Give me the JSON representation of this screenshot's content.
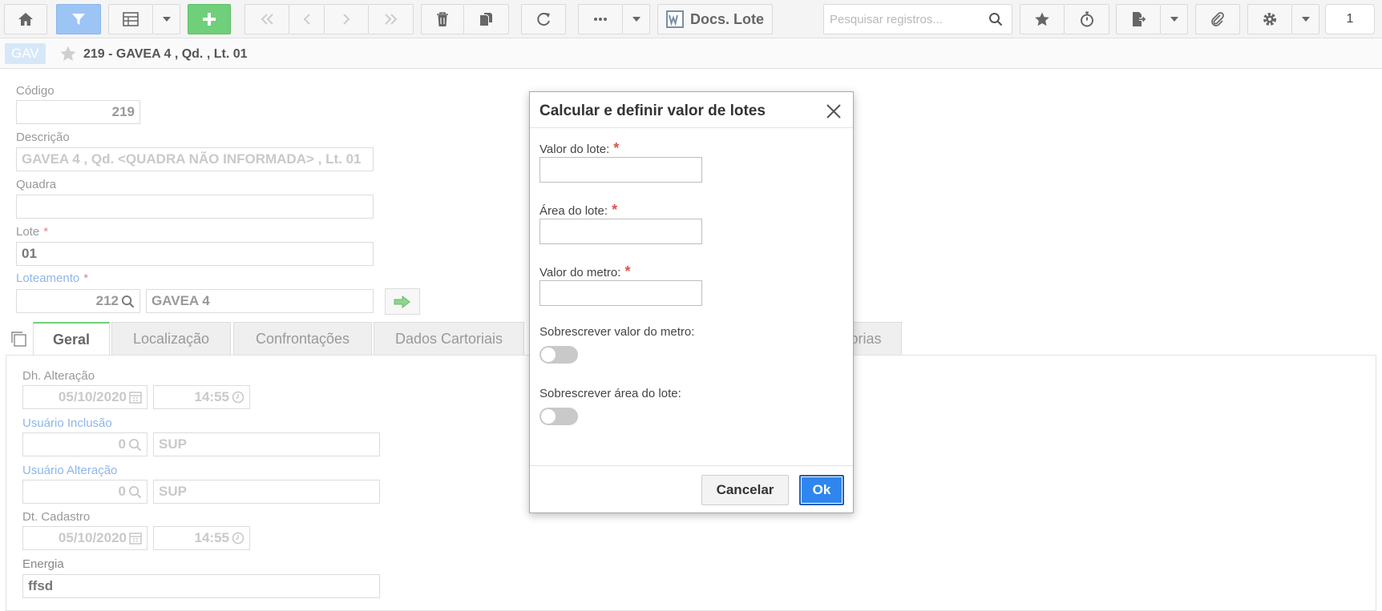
{
  "toolbar": {
    "docs_label": "Docs. Lote",
    "search_placeholder": "Pesquisar registros...",
    "page_number": "1"
  },
  "header": {
    "badge": "GAV",
    "title": "219 - GAVEA 4 , Qd. , Lt. 01"
  },
  "form": {
    "codigo_label": "Código",
    "codigo_value": "219",
    "descricao_label": "Descrição",
    "descricao_value": "GAVEA 4 ,  Qd. <QUADRA NÃO INFORMADA> ,  Lt. 01",
    "quadra_label": "Quadra",
    "quadra_value": "",
    "lote_label": "Lote",
    "lote_value": "01",
    "loteamento_label": "Loteamento",
    "loteamento_code": "212",
    "loteamento_name": "GAVEA 4",
    "required_mark": "*"
  },
  "tabs": [
    {
      "label": "Geral"
    },
    {
      "label": "Localização"
    },
    {
      "label": "Confrontações"
    },
    {
      "label": "Dados Cartoriais"
    },
    {
      "label": "orias"
    }
  ],
  "geral": {
    "dh_alteracao_label": "Dh. Alteração",
    "dh_alteracao_date": "05/10/2020",
    "dh_alteracao_time": "14:55",
    "usuario_inclusao_label": "Usuário Inclusão",
    "usuario_inclusao_code": "0",
    "usuario_inclusao_name": "SUP",
    "usuario_alteracao_label": "Usuário Alteração",
    "usuario_alteracao_code": "0",
    "usuario_alteracao_name": "SUP",
    "dt_cadastro_label": "Dt. Cadastro",
    "dt_cadastro_date": "05/10/2020",
    "dt_cadastro_time": "14:55",
    "energia_label": "Energia",
    "energia_value": "ffsd"
  },
  "modal": {
    "title": "Calcular e definir valor de lotes",
    "valor_lote_label": "Valor do lote:",
    "area_lote_label": "Área do lote:",
    "valor_metro_label": "Valor do metro:",
    "required_mark": "*",
    "sobrescrever_valor_label": "Sobrescrever valor do metro:",
    "sobrescrever_area_label": "Sobrescrever área do lote:",
    "cancel_label": "Cancelar",
    "ok_label": "Ok"
  },
  "icons": {
    "home": "home-icon",
    "filter": "filter-icon",
    "grid": "grid-icon",
    "add": "plus-icon",
    "first": "double-chevron-left-icon",
    "prev": "chevron-left-icon",
    "next": "chevron-right-icon",
    "last": "double-chevron-right-icon",
    "delete": "trash-icon",
    "copy": "copy-icon",
    "refresh": "refresh-icon",
    "more": "ellipsis-icon",
    "word": "word-doc-icon",
    "search": "search-icon",
    "favorite": "star-icon",
    "timer": "stopwatch-icon",
    "export": "export-icon",
    "attach": "paperclip-icon",
    "settings": "gear-icon"
  }
}
